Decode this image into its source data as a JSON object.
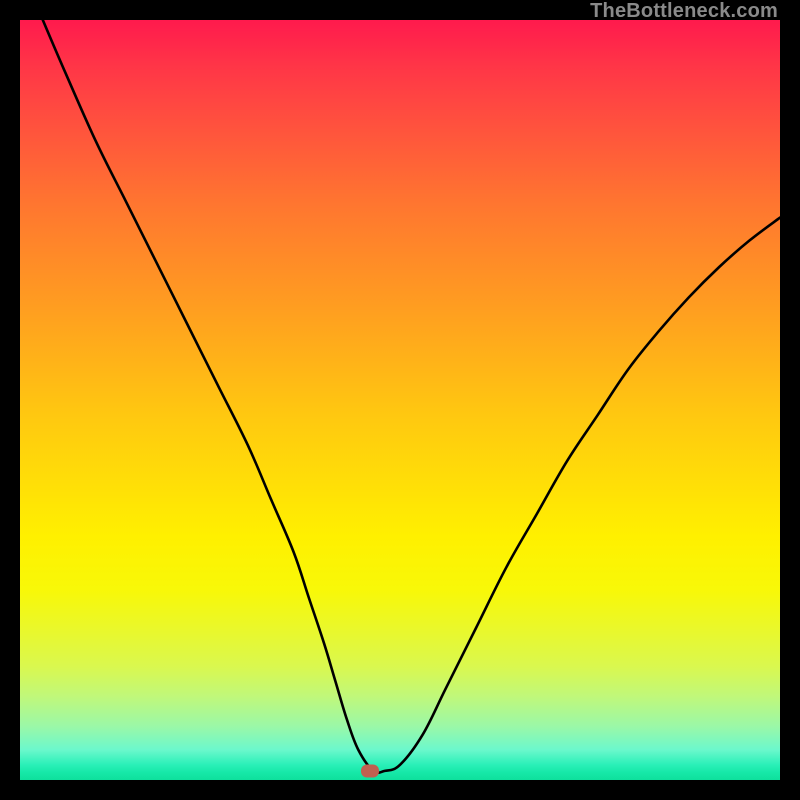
{
  "watermark": "TheBottleneck.com",
  "chart_data": {
    "type": "line",
    "title": "",
    "xlabel": "",
    "ylabel": "",
    "xlim": [
      0,
      100
    ],
    "ylim": [
      0,
      100
    ],
    "series": [
      {
        "name": "curve",
        "x": [
          3,
          6,
          10,
          14,
          18,
          22,
          26,
          30,
          33,
          36,
          38,
          40,
          41.5,
          43,
          44.5,
          46.5,
          48,
          50,
          53,
          56,
          60,
          64,
          68,
          72,
          76,
          80,
          84,
          88,
          92,
          96,
          100
        ],
        "y": [
          100,
          93,
          84,
          76,
          68,
          60,
          52,
          44,
          37,
          30,
          24,
          18,
          13,
          8,
          4,
          1.2,
          1.2,
          2,
          6,
          12,
          20,
          28,
          35,
          42,
          48,
          54,
          59,
          63.5,
          67.5,
          71,
          74
        ]
      }
    ],
    "marker": {
      "x": 46,
      "y": 1.2
    },
    "background": "rainbow-vertical-red-to-green",
    "colors": {
      "curve": "#000000",
      "marker": "#c06050"
    }
  }
}
